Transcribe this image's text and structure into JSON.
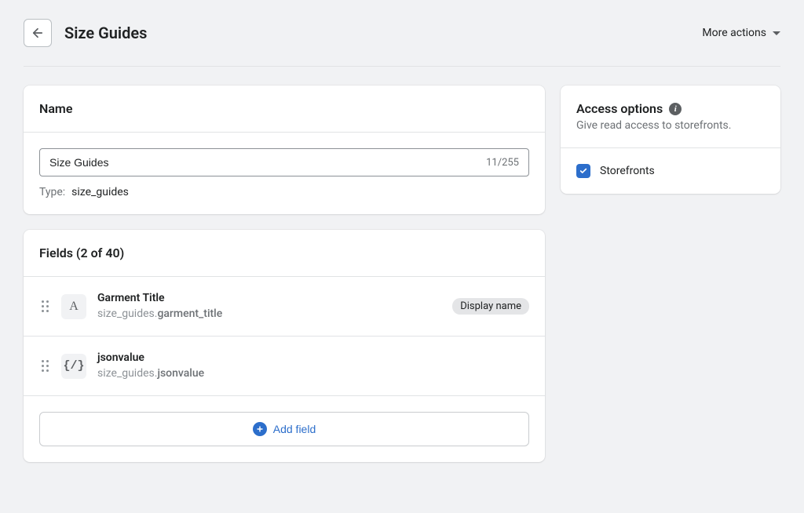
{
  "header": {
    "title": "Size Guides",
    "more_actions_label": "More actions"
  },
  "nameCard": {
    "title": "Name",
    "value": "Size Guides",
    "char_count": "11/255",
    "type_label": "Type:",
    "type_value": "size_guides"
  },
  "fieldsCard": {
    "title": "Fields (2 of 40)",
    "add_label": "Add field",
    "display_badge": "Display name"
  },
  "fields": [
    {
      "icon": "A",
      "name": "Garment Title",
      "key_prefix": "size_guides.",
      "key": "garment_title",
      "displayName": true
    },
    {
      "icon": "{/}",
      "name": "jsonvalue",
      "key_prefix": "size_guides.",
      "key": "jsonvalue",
      "displayName": false
    }
  ],
  "access": {
    "title": "Access options",
    "subtitle": "Give read access to storefronts.",
    "checkbox_label": "Storefronts"
  }
}
